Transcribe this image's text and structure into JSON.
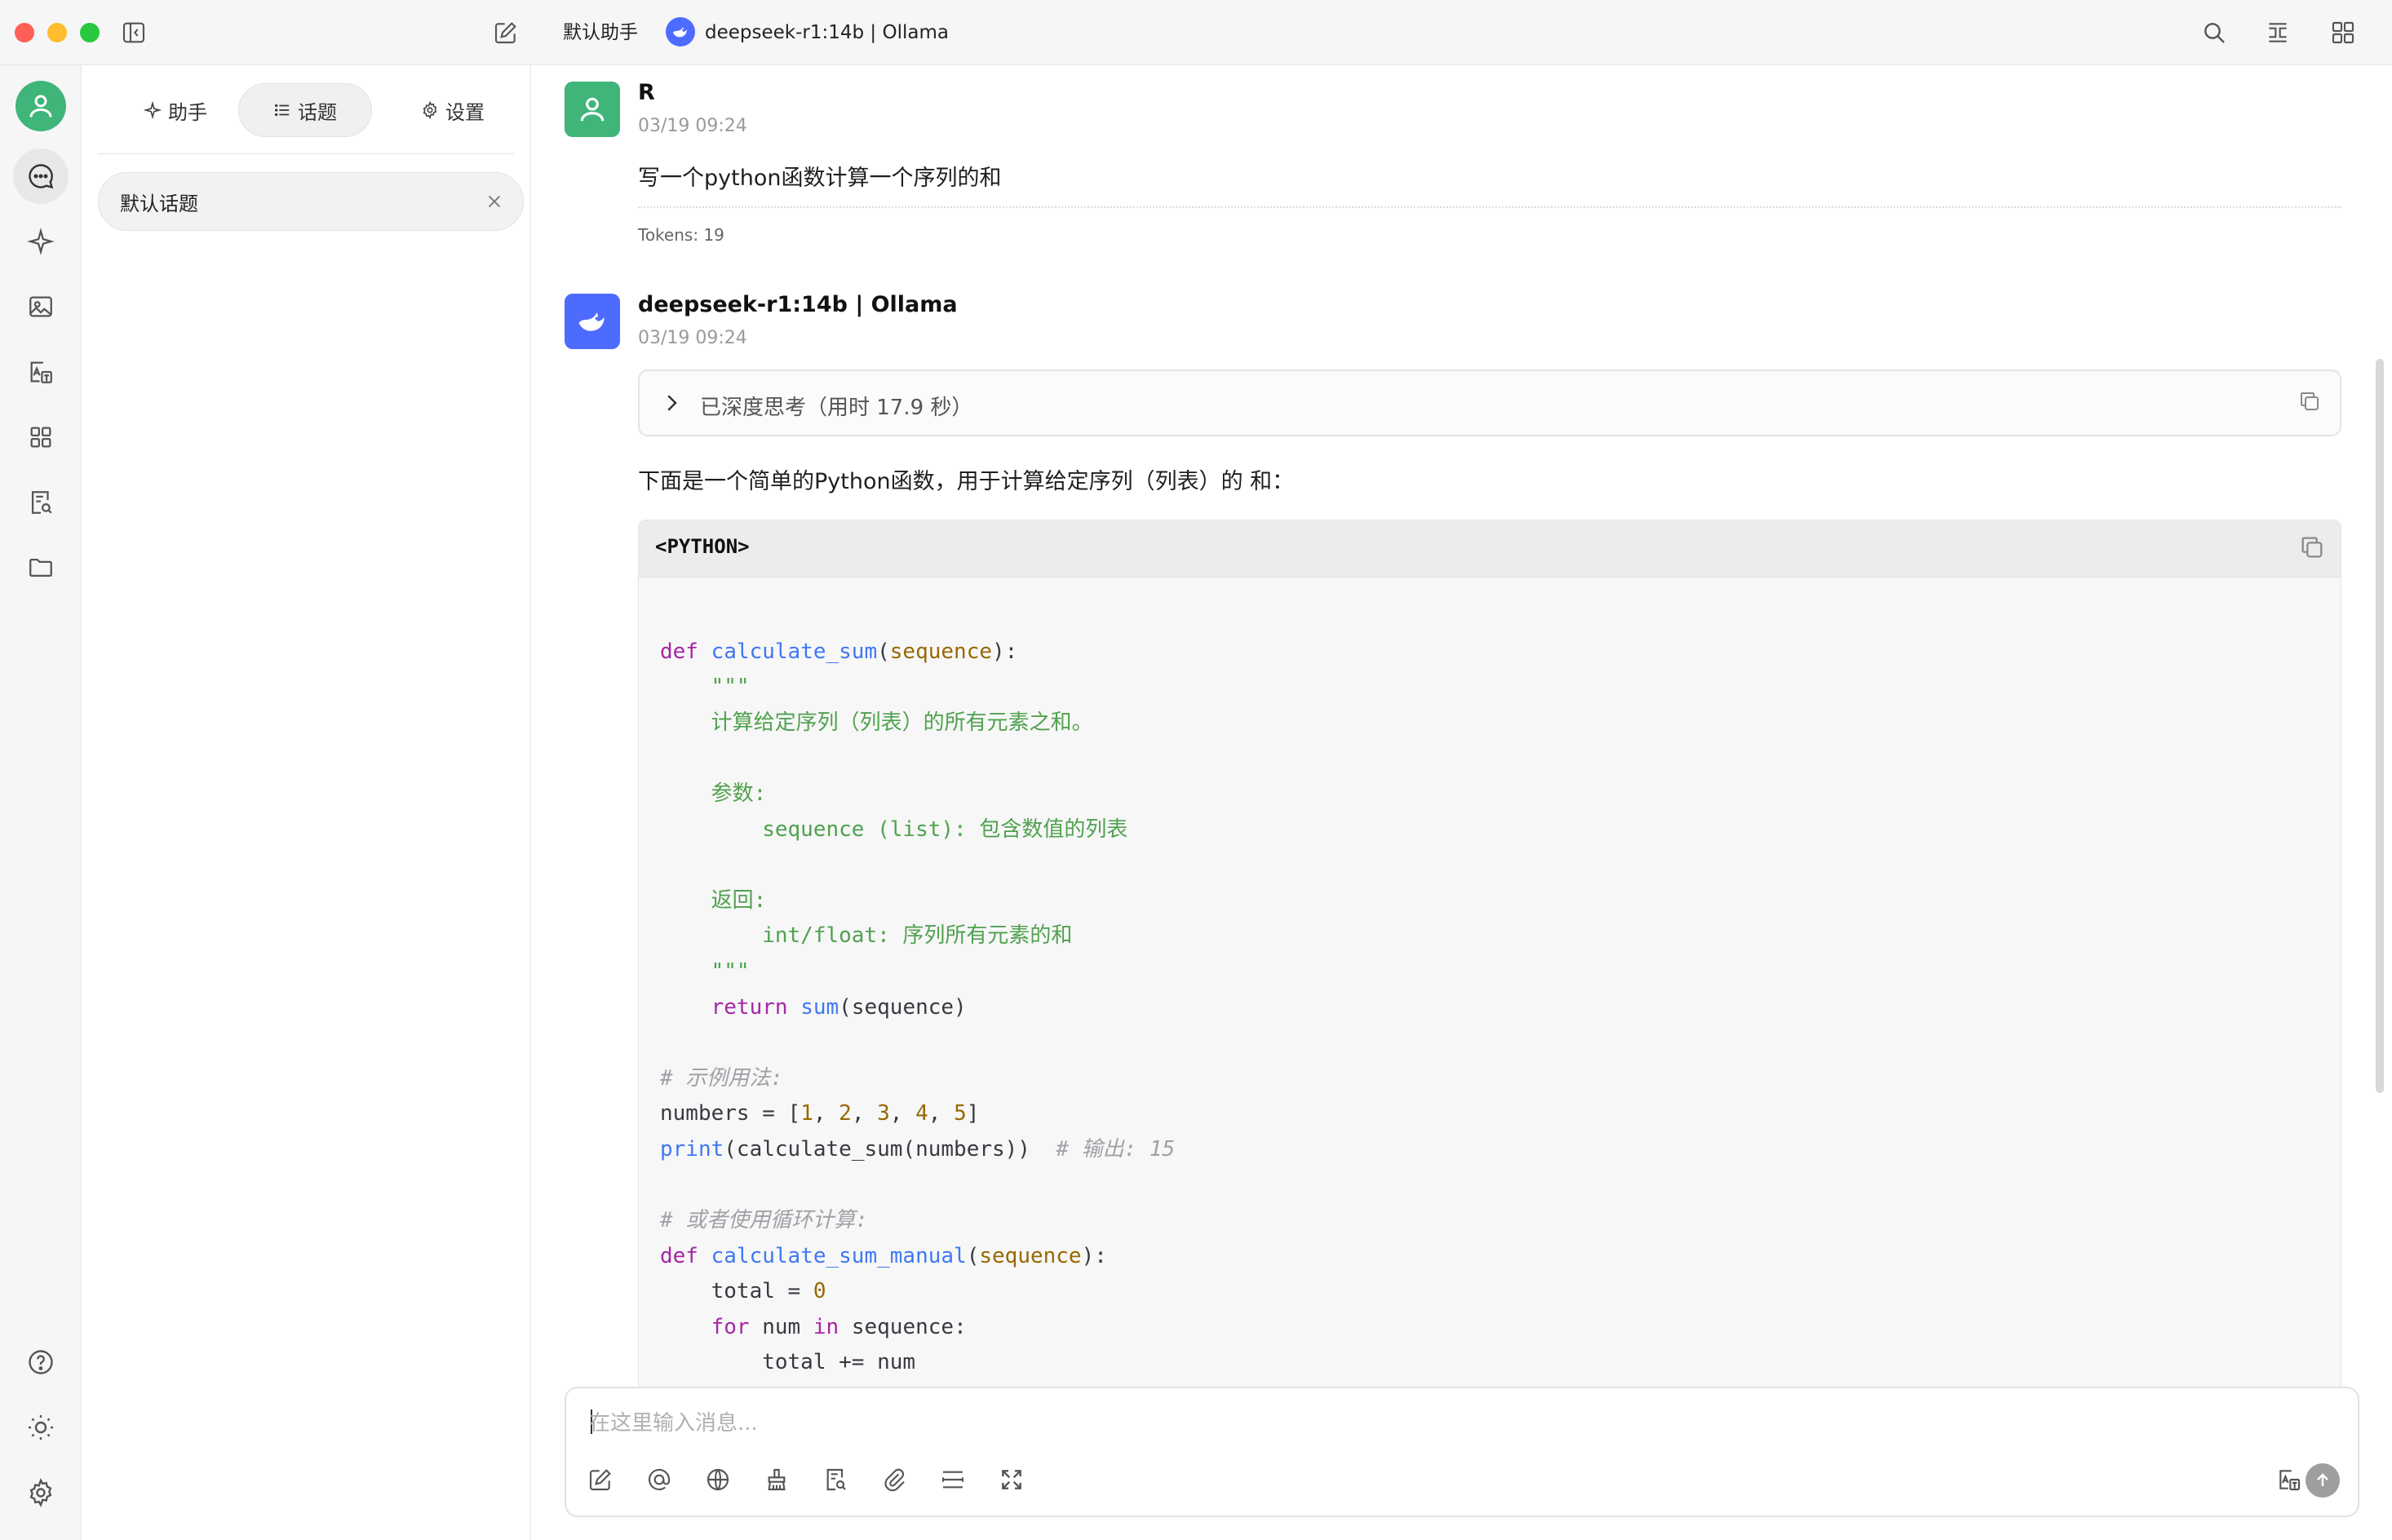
{
  "titlebar": {
    "assistant_name": "默认助手",
    "model_label": "deepseek-r1:14b | Ollama",
    "icons": [
      "sidebar-toggle-icon",
      "new-chat-icon",
      "search-icon",
      "expand-icon",
      "grid-icon"
    ]
  },
  "rail": {
    "items": [
      "avatar",
      "chat-icon",
      "sparkle-icon",
      "image-icon",
      "translate-icon",
      "apps-icon",
      "document-search-icon",
      "folder-icon"
    ],
    "bottom": [
      "help-icon",
      "theme-sun-icon",
      "settings-icon"
    ]
  },
  "panel": {
    "tabs": [
      {
        "label": "助手",
        "active": false
      },
      {
        "label": "话题",
        "active": true
      },
      {
        "label": "设置",
        "active": false
      }
    ],
    "topics": [
      {
        "label": "默认话题"
      }
    ]
  },
  "messages": {
    "user": {
      "sender": "R",
      "time": "03/19 09:24",
      "text": "写一个python函数计算一个序列的和",
      "tokens": "Tokens: 19"
    },
    "assistant": {
      "sender": "deepseek-r1:14b | Ollama",
      "time": "03/19 09:24",
      "thinking_label": "已深度思考（用时 17.9 秒）",
      "intro": "下面是一个简单的Python函数，用于计算给定序列（列表）的 和：",
      "code_lang": "<PYTHON>"
    }
  },
  "input": {
    "placeholder": "在这里输入消息..."
  },
  "colors": {
    "user_avatar": "#3fb57a",
    "model_badge": "#4d6bfe",
    "send_button": "#9e9e9e"
  }
}
